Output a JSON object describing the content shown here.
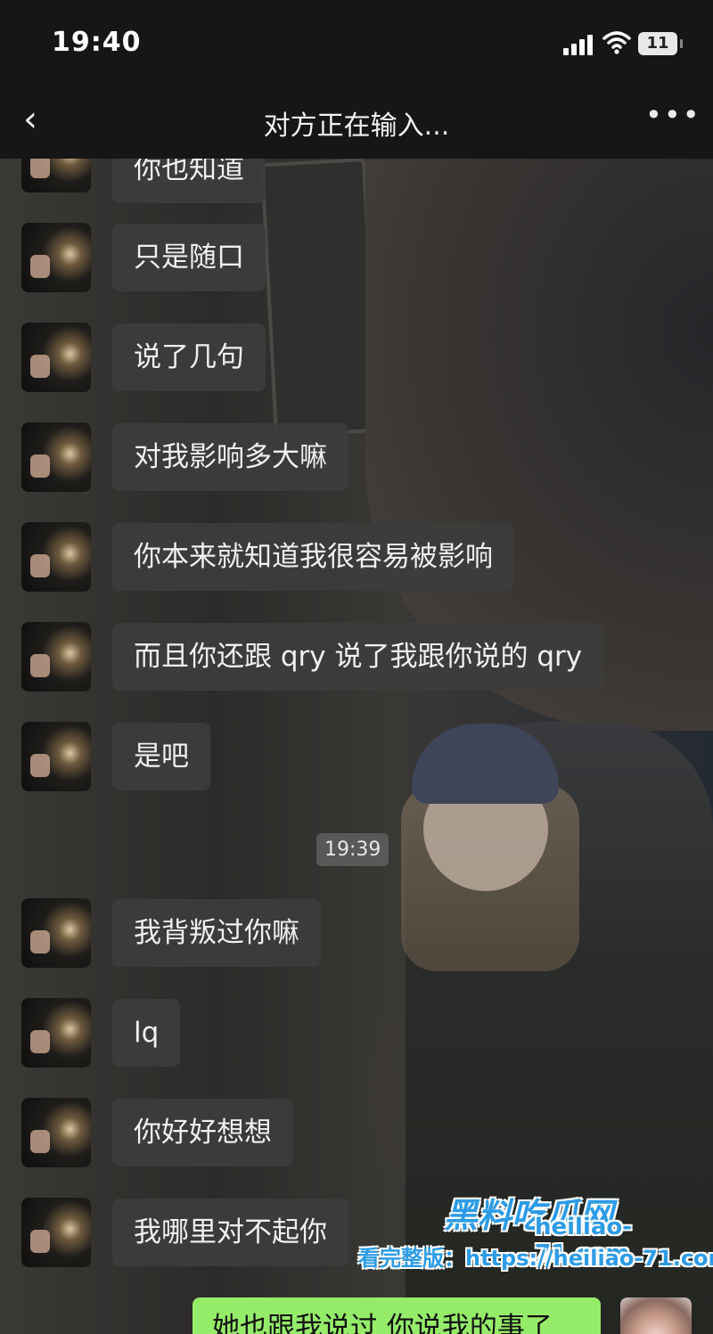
{
  "status_bar": {
    "time": "19:40",
    "battery": "11"
  },
  "nav": {
    "title": "对方正在输入...",
    "back_icon": "chevron-left-icon",
    "more_icon": "more-dots-icon"
  },
  "messages": [
    {
      "text": "你也知道"
    },
    {
      "text": "只是随口"
    },
    {
      "text": "说了几句"
    },
    {
      "text": "对我影响多大嘛"
    },
    {
      "text": "你本来就知道我很容易被影响"
    },
    {
      "text": "而且你还跟 qry 说了我跟你说的 qry"
    },
    {
      "text": "是吧"
    },
    {
      "text": "我背叛过你嘛"
    },
    {
      "text": "lq"
    },
    {
      "text": "你好好想想"
    },
    {
      "text": "我哪里对不起你"
    }
  ],
  "timestamp": "19:39",
  "my_message": {
    "text": "她也跟我说过 你说我的事了"
  },
  "watermark": {
    "site": "黑料吃瓜网",
    "domain": "heiliao-71.com",
    "line": "看完整版：https://heiliao-71.com"
  },
  "colors": {
    "bubble_other": "#3c3c3c",
    "bubble_self": "#95ec69",
    "bar": "#161616"
  }
}
